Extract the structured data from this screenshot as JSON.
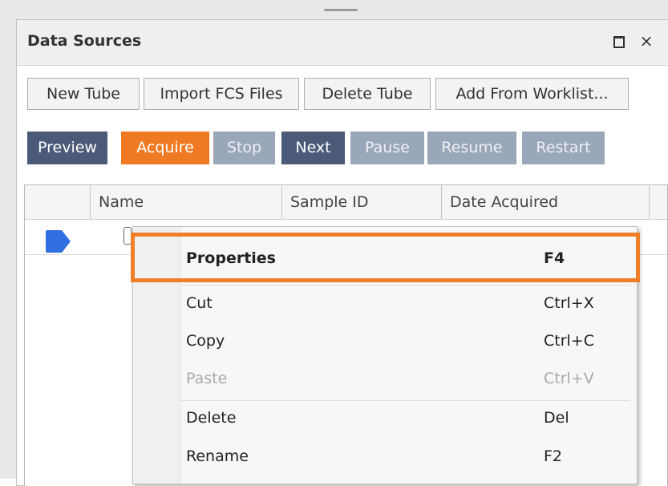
{
  "panel": {
    "title": "Data Sources"
  },
  "window_controls": {
    "maximize_icon": "maximize-icon",
    "close_glyph": "×"
  },
  "toolbar": {
    "buttons": [
      "New Tube",
      "Import FCS Files",
      "Delete Tube",
      "Add From Worklist..."
    ]
  },
  "acquisition": {
    "buttons": [
      {
        "label": "Preview",
        "state": "enabled"
      },
      {
        "label": "Acquire",
        "state": "active"
      },
      {
        "label": "Stop",
        "state": "disabled"
      },
      {
        "label": "Next",
        "state": "enabled"
      },
      {
        "label": "Pause",
        "state": "disabled"
      },
      {
        "label": "Resume",
        "state": "disabled"
      },
      {
        "label": "Restart",
        "state": "disabled"
      }
    ],
    "colors": {
      "enabled": "#4a5a78",
      "active": "#f07a24",
      "disabled": "#9aa6b9"
    }
  },
  "grid": {
    "columns": [
      "Name",
      "Sample ID",
      "Date Acquired"
    ],
    "current_row_indicator_color": "#2f6fe0"
  },
  "context_menu": {
    "items": [
      {
        "label": "Properties",
        "shortcut": "F4",
        "bold": true,
        "enabled": true
      },
      {
        "label": "Cut",
        "shortcut": "Ctrl+X",
        "bold": false,
        "enabled": true
      },
      {
        "label": "Copy",
        "shortcut": "Ctrl+C",
        "bold": false,
        "enabled": true
      },
      {
        "label": "Paste",
        "shortcut": "Ctrl+V",
        "bold": false,
        "enabled": false
      },
      {
        "label": "Delete",
        "shortcut": "Del",
        "bold": false,
        "enabled": true
      },
      {
        "label": "Rename",
        "shortcut": "F2",
        "bold": false,
        "enabled": true
      }
    ],
    "highlight_color": "#f07e2a"
  }
}
